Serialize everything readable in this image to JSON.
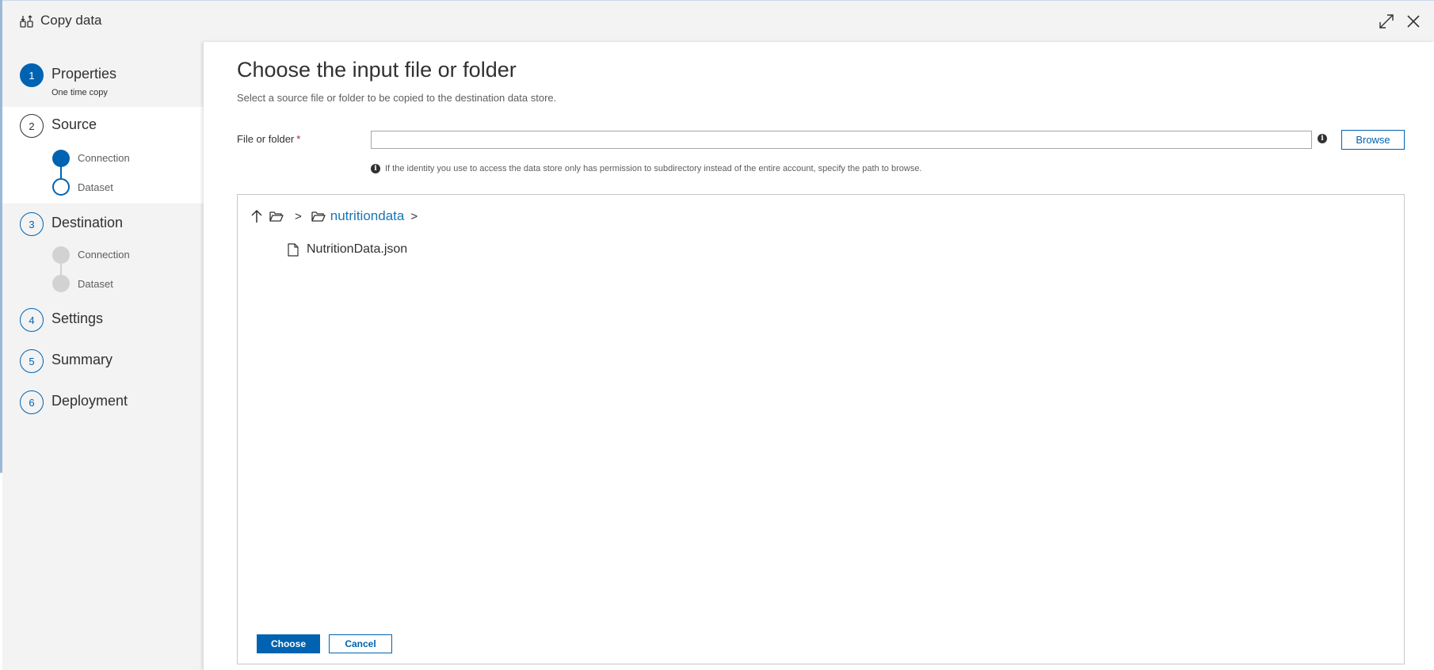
{
  "window": {
    "title": "Copy data",
    "icons": {
      "title": "copy-data-icon",
      "maximize": "maximize-icon",
      "close": "close-icon"
    }
  },
  "sidebar": {
    "steps": [
      {
        "number": "1",
        "label": "Properties",
        "sub": "One time copy",
        "state": "completed"
      },
      {
        "number": "2",
        "label": "Source",
        "state": "current",
        "substeps": [
          {
            "label": "Connection",
            "state": "completed"
          },
          {
            "label": "Dataset",
            "state": "current"
          }
        ]
      },
      {
        "number": "3",
        "label": "Destination",
        "state": "pending",
        "substeps": [
          {
            "label": "Connection",
            "state": "pending"
          },
          {
            "label": "Dataset",
            "state": "pending"
          }
        ]
      },
      {
        "number": "4",
        "label": "Settings",
        "state": "pending"
      },
      {
        "number": "5",
        "label": "Summary",
        "state": "pending"
      },
      {
        "number": "6",
        "label": "Deployment",
        "state": "pending"
      }
    ]
  },
  "main": {
    "title": "Choose the input file or folder",
    "subtitle": "Select a source file or folder to be copied to the destination data store.",
    "field_label": "File or folder",
    "required_mark": "*",
    "file_value": "",
    "info_glyph": "i",
    "browse_label": "Browse",
    "hint": "If the identity you use to access the data store only has permission to subdirectory instead of the entire account, specify the path to browse.",
    "browser": {
      "separator": ">",
      "current_folder": "nutritiondata",
      "items": [
        {
          "name": "NutritionData.json",
          "type": "file"
        }
      ]
    },
    "choose_label": "Choose",
    "cancel_label": "Cancel"
  },
  "colors": {
    "accent": "#0063b1",
    "link": "#1a75b3",
    "sidebar_bg": "#f3f3f3",
    "required": "#a4262c"
  }
}
